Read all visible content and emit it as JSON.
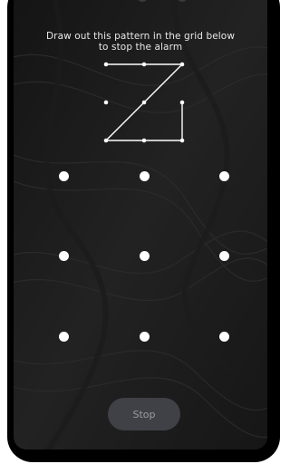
{
  "instruction": {
    "line1": "Draw out this pattern in the grid below",
    "line2": "to stop the alarm"
  },
  "pattern": {
    "sequence": [
      1,
      2,
      3,
      5,
      7,
      8,
      9,
      6
    ],
    "description_grid": "3x3",
    "line_color": "#ffffff"
  },
  "input_grid": {
    "rows": 3,
    "cols": 3,
    "dot_color": "#ffffff"
  },
  "stop_button": {
    "label": "Stop",
    "background": "#3f4146",
    "text_color": "#9a9ca1"
  },
  "colors": {
    "screen_background": "#1b1b1b",
    "device_frame": "#000000"
  }
}
